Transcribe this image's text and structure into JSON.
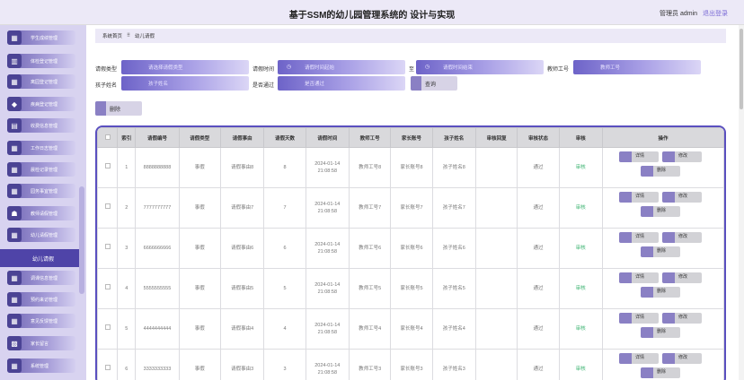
{
  "header": {
    "title": "基于SSM的幼儿园管理系统的 设计与实现",
    "user": "管理员 admin",
    "logout": "退出登录"
  },
  "sidebar": {
    "items": [
      {
        "label": "学生成绩管理"
      },
      {
        "label": "体检登记管理"
      },
      {
        "label": "离园登记管理"
      },
      {
        "label": "疾病登记管理"
      },
      {
        "label": "收费信息管理"
      },
      {
        "label": "工作日志管理"
      },
      {
        "label": "晨检记录管理"
      },
      {
        "label": "园务事宜管理"
      },
      {
        "label": "教师请假管理"
      },
      {
        "label": "幼儿请假管理"
      },
      {
        "label": "调课信息管理"
      },
      {
        "label": "预约来访管理"
      },
      {
        "label": "意见反馈管理"
      },
      {
        "label": "家长留言"
      },
      {
        "label": "系统管理"
      }
    ],
    "active": "幼儿请假"
  },
  "breadcrumb": {
    "home": "系统首页",
    "sep": "⠿",
    "current": "幼儿请假"
  },
  "search": {
    "leave_type_label": "请假类型",
    "leave_type_ph": "请选择请假类型",
    "leave_time_label": "请假时间",
    "start_ph": "请假时间起始",
    "to_label": "至",
    "end_ph": "请假时间结束",
    "teacher_no_label": "教师工号",
    "teacher_no_ph": "教师工号",
    "child_name_label": "孩子姓名",
    "child_name_ph": "孩子姓名",
    "approved_label": "是否通过",
    "approved_ph": "是否通过",
    "query_button": "查询",
    "delete_button": "删除"
  },
  "table": {
    "headers": [
      "索引",
      "请假编号",
      "请假类型",
      "请假事由",
      "请假天数",
      "请假时间",
      "教师工号",
      "家长账号",
      "孩子姓名",
      "审核回复",
      "审核状态",
      "审核",
      "操作"
    ],
    "ops": {
      "detail": "详情",
      "edit": "修改",
      "delete": "删除"
    },
    "rows": [
      {
        "idx": "1",
        "no": "8888888888",
        "type": "事假",
        "reason": "请假事由8",
        "days": "8",
        "date": "2024-01-14",
        "time": "21:08:58",
        "teacher": "教师工号8",
        "parent": "家长账号8",
        "child": "孩子姓名8",
        "reply": "",
        "status": "通过",
        "audit": "审核"
      },
      {
        "idx": "2",
        "no": "7777777777",
        "type": "事假",
        "reason": "请假事由7",
        "days": "7",
        "date": "2024-01-14",
        "time": "21:08:58",
        "teacher": "教师工号7",
        "parent": "家长账号7",
        "child": "孩子姓名7",
        "reply": "",
        "status": "通过",
        "audit": "审核"
      },
      {
        "idx": "3",
        "no": "6666666666",
        "type": "事假",
        "reason": "请假事由6",
        "days": "6",
        "date": "2024-01-14",
        "time": "21:08:58",
        "teacher": "教师工号6",
        "parent": "家长账号6",
        "child": "孩子姓名6",
        "reply": "",
        "status": "通过",
        "audit": "审核"
      },
      {
        "idx": "4",
        "no": "5555555555",
        "type": "事假",
        "reason": "请假事由5",
        "days": "5",
        "date": "2024-01-14",
        "time": "21:08:58",
        "teacher": "教师工号5",
        "parent": "家长账号5",
        "child": "孩子姓名5",
        "reply": "",
        "status": "通过",
        "audit": "审核"
      },
      {
        "idx": "5",
        "no": "4444444444",
        "type": "事假",
        "reason": "请假事由4",
        "days": "4",
        "date": "2024-01-14",
        "time": "21:08:58",
        "teacher": "教师工号4",
        "parent": "家长账号4",
        "child": "孩子姓名4",
        "reply": "",
        "status": "通过",
        "audit": "审核"
      },
      {
        "idx": "6",
        "no": "3333333333",
        "type": "事假",
        "reason": "请假事由3",
        "days": "3",
        "date": "2024-01-14",
        "time": "21:08:58",
        "teacher": "教师工号3",
        "parent": "家长账号3",
        "child": "孩子姓名3",
        "reply": "",
        "status": "通过",
        "audit": "审核"
      }
    ]
  }
}
